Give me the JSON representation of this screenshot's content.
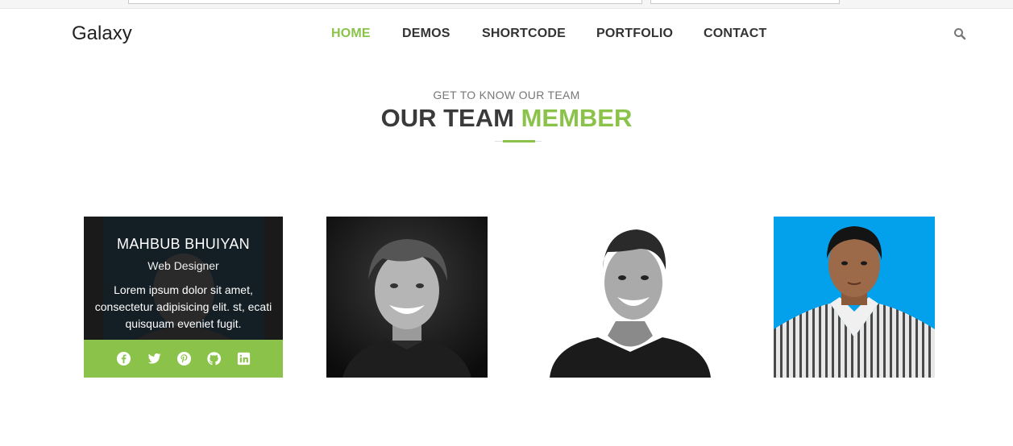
{
  "brand": "Galaxy",
  "nav": {
    "items": [
      {
        "label": "HOME",
        "active": true
      },
      {
        "label": "DEMOS"
      },
      {
        "label": "SHORTCODE"
      },
      {
        "label": "PORTFOLIO"
      },
      {
        "label": "CONTACT"
      }
    ]
  },
  "section": {
    "subtitle": "GET TO KNOW OUR TEAM",
    "title_main": "OUR TEAM",
    "title_highlight": "MEMBER"
  },
  "team": {
    "featured": {
      "name": "MAHBUB BHUIYAN",
      "role": "Web Designer",
      "description": "Lorem ipsum dolor sit amet, consectetur adipisicing elit. st, ecati quisquam eveniet fugit.",
      "social": [
        "facebook-icon",
        "twitter-icon",
        "pinterest-icon",
        "github-icon",
        "linkedin-icon"
      ]
    }
  },
  "colors": {
    "accent": "#8bc34a",
    "heading": "#3a3a3a",
    "blue_bg": "#03a0ec"
  }
}
